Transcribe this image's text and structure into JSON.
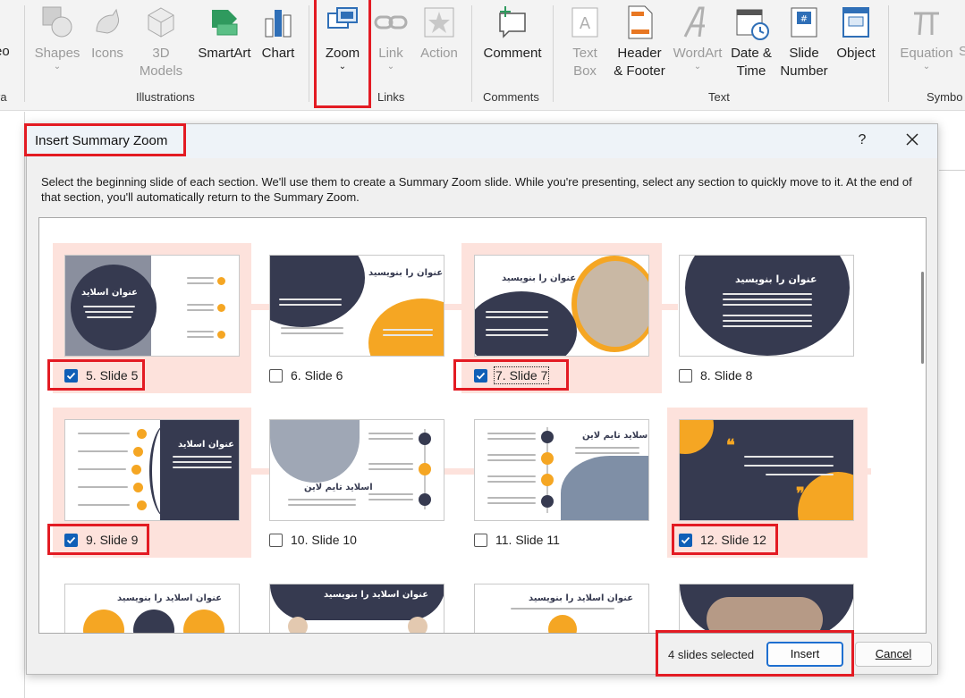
{
  "ribbon": {
    "partial_left_top": "eo",
    "partial_left_bottom": "ra",
    "items": {
      "shapes": "Shapes",
      "icons": "Icons",
      "models": "3D\nModels",
      "smartart": "SmartArt",
      "chart": "Chart",
      "zoom": "Zoom",
      "link": "Link",
      "action": "Action",
      "comment": "Comment",
      "textbox": "Text\nBox",
      "header_footer": "Header\n& Footer",
      "wordart": "WordArt",
      "date_time": "Date &\nTime",
      "slide_number": "Slide\nNumber",
      "object": "Object",
      "equation": "Equation",
      "partial_symbol": "S"
    },
    "groups": {
      "illustrations": "Illustrations",
      "links": "Links",
      "comments": "Comments",
      "text": "Text",
      "symbols": "Symbo"
    }
  },
  "dialog": {
    "title": "Insert Summary Zoom",
    "help": "?",
    "instructions": "Select the beginning slide of each section. We'll use them to create a Summary Zoom slide. While you're presenting, select any section to quickly move to it. At the end of that section, you'll automatically return to the Summary Zoom.",
    "slides": [
      {
        "label": "5. Slide 5",
        "checked": true,
        "title_text": "عنوان اسلاید"
      },
      {
        "label": "6. Slide 6",
        "checked": false,
        "title_text": "عنوان را بنویسید"
      },
      {
        "label": "7. Slide 7",
        "checked": true,
        "title_text": "عنوان را بنویسید"
      },
      {
        "label": "8. Slide 8",
        "checked": false,
        "title_text": "عنوان را بنویسید"
      },
      {
        "label": "9. Slide 9",
        "checked": true,
        "title_text": "عنوان اسلاید"
      },
      {
        "label": "10. Slide 10",
        "checked": false,
        "title_text": "اسلاید تایم لاین"
      },
      {
        "label": "11. Slide 11",
        "checked": false,
        "title_text": "اسلاید تایم لاین"
      },
      {
        "label": "12. Slide 12",
        "checked": true,
        "title_text": ""
      }
    ],
    "row3_titles": [
      "عنوان اسلاید را بنویسید",
      "عنوان اسلاید را بنویسید",
      "عنوان اسلاید را بنویسید"
    ],
    "selected_count": "4 slides selected",
    "insert_label": "Insert",
    "cancel_label": "Cancel"
  },
  "colors": {
    "accent_red": "#e31b23",
    "checkbox_blue": "#0f5fb7",
    "section_pink": "#fde2dc",
    "slide_dark": "#363a50",
    "slide_orange": "#f5a623"
  }
}
